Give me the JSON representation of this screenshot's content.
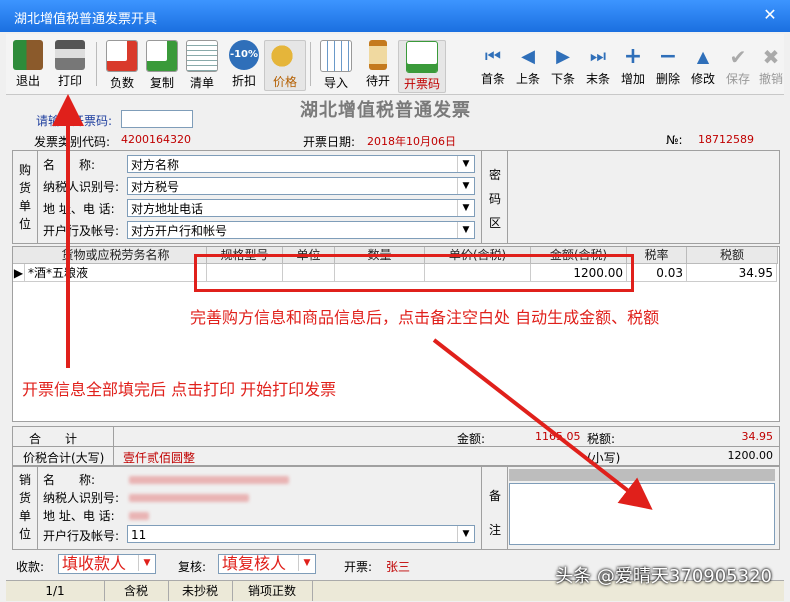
{
  "window": {
    "title": "湖北增值税普通发票开具"
  },
  "toolbar": {
    "left": [
      "退出",
      "打印",
      "负数",
      "复制",
      "清单",
      "折扣",
      "价格",
      "导入",
      "待开",
      "开票码"
    ],
    "discount_badge": "-10%",
    "right": [
      "首条",
      "上条",
      "下条",
      "末条",
      "增加",
      "删除",
      "修改",
      "保存",
      "撤销"
    ]
  },
  "invoice": {
    "heading": "湖北增值税普通发票",
    "code_prompt": "请输入开票码:",
    "code_value": "",
    "type_code_label": "发票类别代码:",
    "type_code": "4200164320",
    "date_label": "开票日期:",
    "date": "2018年10月06日",
    "no_label": "№:",
    "no": "18712589"
  },
  "buyer": {
    "side_label": [
      "购",
      "货",
      "单",
      "位"
    ],
    "rows": [
      {
        "label": "名　　称:",
        "value": "对方名称"
      },
      {
        "label": "纳税人识别号:",
        "value": "对方税号"
      },
      {
        "label": "地 址、电 话:",
        "value": "对方地址电话"
      },
      {
        "label": "开户行及帐号:",
        "value": "对方开户行和帐号"
      }
    ],
    "cipher_label": [
      "密",
      "码",
      "区"
    ]
  },
  "items": {
    "headers": [
      "货物或应税劳务名称",
      "规格型号",
      "单位",
      "数量",
      "单价(含税)",
      "金额(含税)",
      "税率",
      "税额"
    ],
    "rows": [
      {
        "name": "*酒*五粮液",
        "spec": "",
        "unit": "",
        "qty": "",
        "price": "",
        "amount": "1200.00",
        "rate": "0.03",
        "tax": "34.95"
      }
    ]
  },
  "totals": {
    "sum_label": "合　　计",
    "amount_label": "金额:",
    "amount": "1165.05",
    "tax_label": "税额:",
    "tax": "34.95",
    "capital_label": "价税合计(大写)",
    "capital": "壹仟贰佰圆整",
    "small_label": "(小写)",
    "small": "1200.00"
  },
  "seller": {
    "side_label": [
      "销",
      "货",
      "单",
      "位"
    ],
    "rows": [
      {
        "label": "名　　称:"
      },
      {
        "label": "纳税人识别号:"
      },
      {
        "label": "地 址、电 话:"
      },
      {
        "label": "开户行及帐号:",
        "value": "11"
      }
    ],
    "remark_label": [
      "备",
      "注"
    ]
  },
  "signoff": {
    "payee_label": "收款:",
    "payee": "填收款人",
    "reviewer_label": "复核:",
    "reviewer": "填复核人",
    "issuer_label": "开票:",
    "issuer": "张三"
  },
  "status": [
    "1/1",
    "含税",
    "未抄税",
    "销项正数"
  ],
  "annotations": {
    "top": "完善购方信息和商品信息后，点击备注空白处 自动生成金额、税额",
    "left": "开票信息全部填完后 点击打印 开始打印发票"
  },
  "watermark": "头条 @爱晴天370905320",
  "colors": {
    "title_blue": "#1A6FE0",
    "annotation_red": "#E0201B",
    "value_red": "#C00000"
  }
}
